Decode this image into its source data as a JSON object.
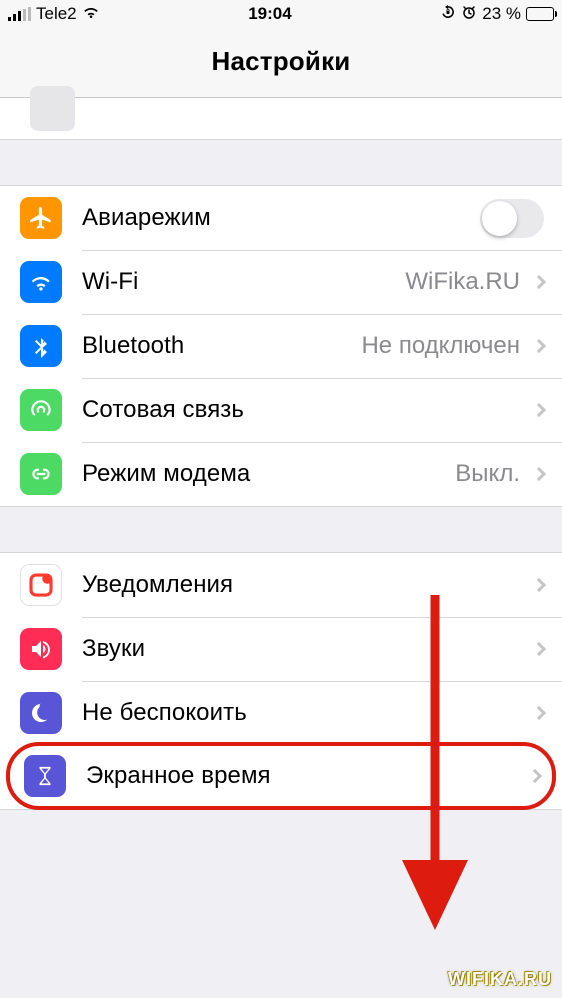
{
  "status": {
    "carrier": "Tele2",
    "time": "19:04",
    "battery_pct": "23 %"
  },
  "header": {
    "title": "Настройки"
  },
  "group1": [
    {
      "id": "airplane",
      "label": "Авиарежим",
      "detail": "",
      "icon_bg": "#ff9500",
      "has_toggle": true,
      "toggle_on": false
    },
    {
      "id": "wifi",
      "label": "Wi-Fi",
      "detail": "WiFika.RU",
      "icon_bg": "#007aff",
      "has_chevron": true
    },
    {
      "id": "bluetooth",
      "label": "Bluetooth",
      "detail": "Не подключен",
      "icon_bg": "#007aff",
      "has_chevron": true
    },
    {
      "id": "cellular",
      "label": "Сотовая связь",
      "detail": "",
      "icon_bg": "#4cd964",
      "has_chevron": true
    },
    {
      "id": "hotspot",
      "label": "Режим модема",
      "detail": "Выкл.",
      "icon_bg": "#4cd964",
      "has_chevron": true
    }
  ],
  "group2": [
    {
      "id": "notifications",
      "label": "Уведомления",
      "detail": "",
      "icon_bg": "#ff3b30",
      "has_chevron": true
    },
    {
      "id": "sounds",
      "label": "Звуки",
      "detail": "",
      "icon_bg": "#ff2d55",
      "has_chevron": true
    },
    {
      "id": "dnd",
      "label": "Не беспокоить",
      "detail": "",
      "icon_bg": "#5856d6",
      "has_chevron": true
    },
    {
      "id": "screentime",
      "label": "Экранное время",
      "detail": "",
      "icon_bg": "#5856d6",
      "has_chevron": true,
      "highlighted": true
    }
  ],
  "annotation": {
    "type": "arrow",
    "color": "#dd1b0f"
  },
  "watermark": "WIFIKA.RU"
}
